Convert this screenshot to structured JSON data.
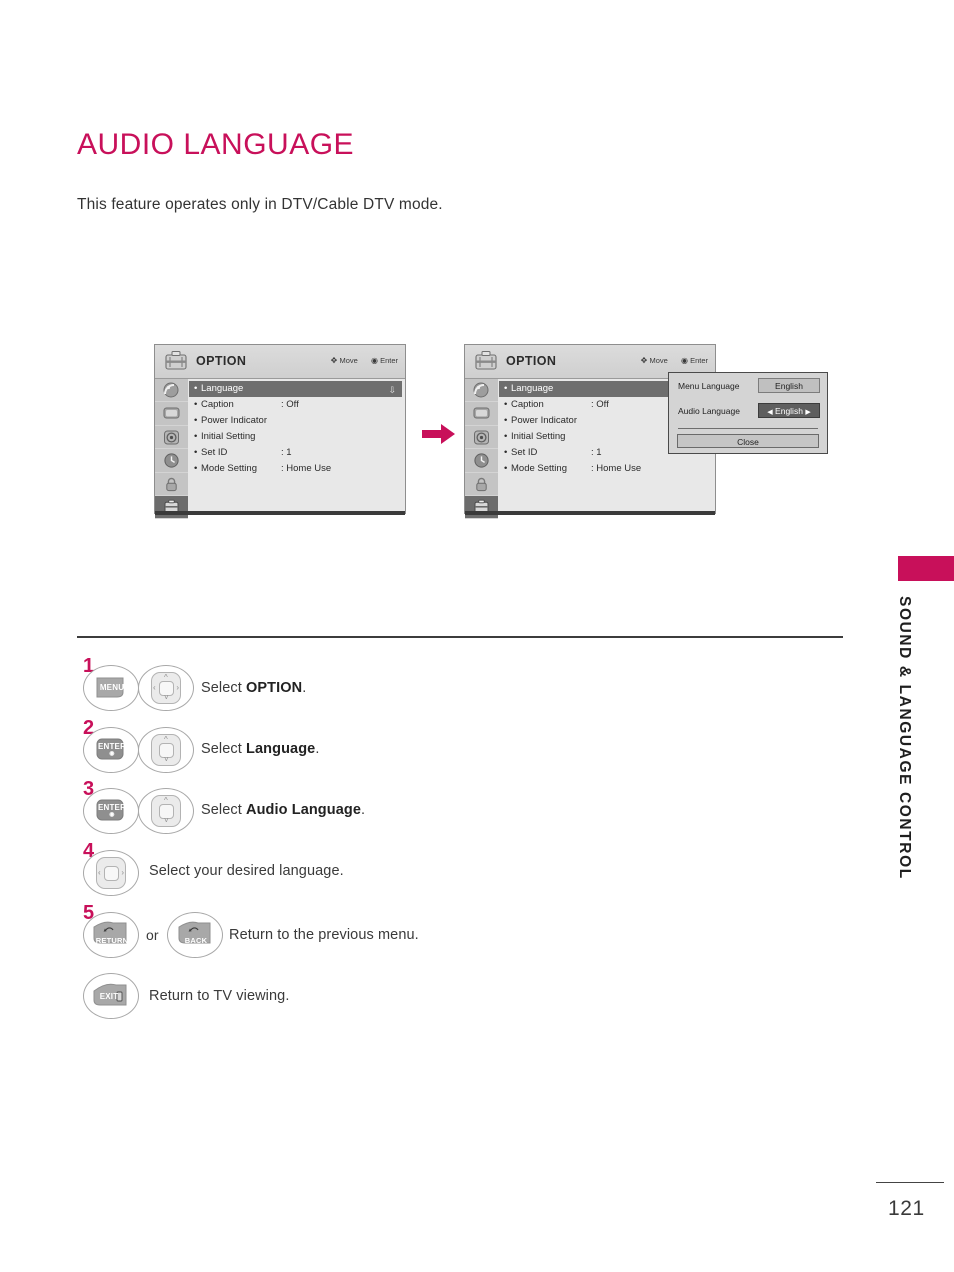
{
  "page": {
    "title": "AUDIO LANGUAGE",
    "intro": "This feature operates only in DTV/Cable DTV mode.",
    "number": "121",
    "side_label": "SOUND & LANGUAGE CONTROL",
    "accent_color": "#c8105a"
  },
  "osd": {
    "title": "OPTION",
    "hint_move": "Move",
    "hint_enter": "Enter",
    "rows": [
      {
        "bullet": "•",
        "label": "Language",
        "value": "",
        "selected": true,
        "indicator": "⇩"
      },
      {
        "bullet": "•",
        "label": "Caption",
        "value": ": Off",
        "selected": false,
        "indicator": ""
      },
      {
        "bullet": "•",
        "label": "Power Indicator",
        "value": "",
        "selected": false,
        "indicator": ""
      },
      {
        "bullet": "•",
        "label": "Initial Setting",
        "value": "",
        "selected": false,
        "indicator": ""
      },
      {
        "bullet": "•",
        "label": "Set ID",
        "value": ": 1",
        "selected": false,
        "indicator": ""
      },
      {
        "bullet": "•",
        "label": "Mode Setting",
        "value": ": Home Use",
        "selected": false,
        "indicator": ""
      }
    ],
    "rail_icons": [
      "satellite-icon",
      "monitor-icon",
      "settings-icon",
      "clock-icon",
      "lock-icon",
      "option-briefcase-icon"
    ]
  },
  "popup": {
    "menu_language_label": "Menu Language",
    "menu_language_value": "English",
    "audio_language_label": "Audio Language",
    "audio_language_value": "English",
    "audio_left_arrow": "◀",
    "audio_right_arrow": "▶",
    "close_label": "Close"
  },
  "steps": [
    {
      "num": "1",
      "keys": [
        "MENU",
        "navpad-4way"
      ],
      "text_prefix": "Select ",
      "text_bold": "OPTION",
      "text_suffix": "."
    },
    {
      "num": "2",
      "keys": [
        "ENTER",
        "navpad-updown"
      ],
      "text_prefix": "Select ",
      "text_bold": "Language",
      "text_suffix": "."
    },
    {
      "num": "3",
      "keys": [
        "ENTER",
        "navpad-updown"
      ],
      "text_prefix": "Select ",
      "text_bold": "Audio Language",
      "text_suffix": "."
    },
    {
      "num": "4",
      "keys": [
        "navpad-leftright"
      ],
      "text_prefix": "Select your desired language.",
      "text_bold": "",
      "text_suffix": ""
    },
    {
      "num": "5",
      "keys": [
        "RETURN",
        "BACK"
      ],
      "text_prefix": "Return to the previous menu.",
      "text_bold": "",
      "text_suffix": "",
      "conjunction": "or"
    },
    {
      "num": "",
      "keys": [
        "EXIT"
      ],
      "text_prefix": "Return to TV viewing.",
      "text_bold": "",
      "text_suffix": ""
    }
  ],
  "key_labels": {
    "menu": "MENU",
    "enter": "ENTER",
    "enter_glyph": "◉",
    "return": "RETURN",
    "back": "BACK",
    "exit": "EXIT",
    "or": "or"
  }
}
